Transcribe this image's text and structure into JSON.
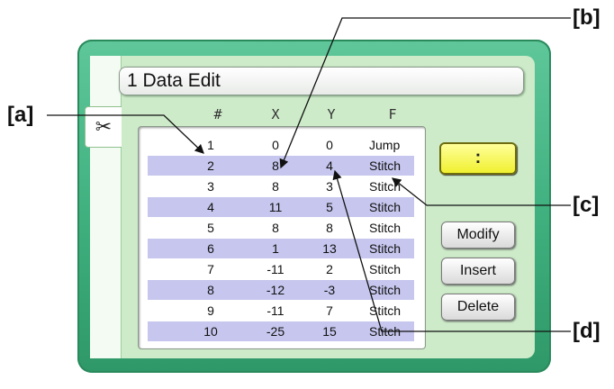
{
  "window": {
    "title": "1 Data Edit"
  },
  "tab": {
    "icon": "stitch-tool-icon"
  },
  "columns": [
    "#",
    "X",
    "Y",
    "F"
  ],
  "rows": [
    {
      "num": "1",
      "x": "0",
      "y": "0",
      "f": "Jump"
    },
    {
      "num": "2",
      "x": "8",
      "y": "4",
      "f": "Stitch"
    },
    {
      "num": "3",
      "x": "8",
      "y": "3",
      "f": "Stitch"
    },
    {
      "num": "4",
      "x": "11",
      "y": "5",
      "f": "Stitch"
    },
    {
      "num": "5",
      "x": "8",
      "y": "8",
      "f": "Stitch"
    },
    {
      "num": "6",
      "x": "1",
      "y": "13",
      "f": "Stitch"
    },
    {
      "num": "7",
      "x": "-11",
      "y": "2",
      "f": "Stitch"
    },
    {
      "num": "8",
      "x": "-12",
      "y": "-3",
      "f": "Stitch"
    },
    {
      "num": "9",
      "x": "-11",
      "y": "7",
      "f": "Stitch"
    },
    {
      "num": "10",
      "x": "-25",
      "y": "15",
      "f": "Stitch"
    }
  ],
  "buttons": {
    "colon": ":",
    "modify": "Modify",
    "insert": "Insert",
    "delete": "Delete"
  },
  "callouts": {
    "a": "[a]",
    "b": "[b]",
    "c": "[c]",
    "d": "[d]"
  },
  "colors": {
    "frame": "#3faf7e",
    "inner": "#cdebc9",
    "alt_row": "#c6c6ee",
    "yellow_button": "#f0f030"
  }
}
